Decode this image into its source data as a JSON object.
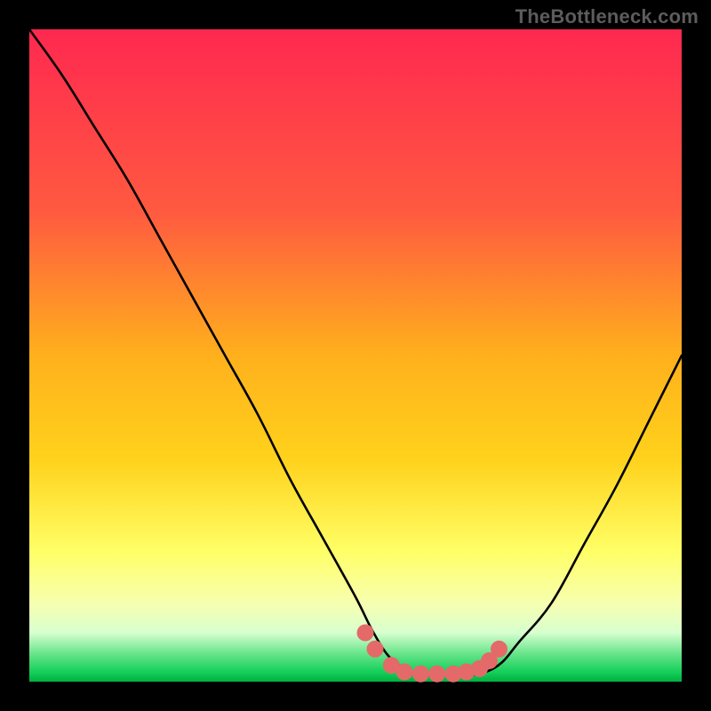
{
  "attribution": "TheBottleneck.com",
  "colors": {
    "frame": "#000000",
    "gradient_top": "#ff2850",
    "gradient_mid1": "#ff7a3a",
    "gradient_mid2": "#ffd21c",
    "gradient_mid3": "#ffff66",
    "gradient_mid4": "#f7ffb0",
    "gradient_bottom_band1": "#d7ffcf",
    "gradient_bottom_band2": "#6fe68f",
    "gradient_bottom_band3": "#15d05a",
    "curve": "#000000",
    "dots": "#e46a6a"
  },
  "chart_data": {
    "type": "line",
    "title": "",
    "xlabel": "",
    "ylabel": "",
    "x": [
      0.0,
      0.05,
      0.1,
      0.15,
      0.2,
      0.25,
      0.3,
      0.35,
      0.4,
      0.45,
      0.5,
      0.525,
      0.55,
      0.575,
      0.6,
      0.625,
      0.65,
      0.675,
      0.7,
      0.725,
      0.75,
      0.8,
      0.85,
      0.9,
      0.95,
      1.0
    ],
    "series": [
      {
        "name": "bottleneck-curve",
        "values": [
          1.0,
          0.93,
          0.85,
          0.77,
          0.68,
          0.59,
          0.5,
          0.41,
          0.31,
          0.22,
          0.13,
          0.08,
          0.04,
          0.02,
          0.01,
          0.01,
          0.01,
          0.01,
          0.015,
          0.03,
          0.06,
          0.12,
          0.21,
          0.3,
          0.4,
          0.5
        ]
      }
    ],
    "highlight_points": {
      "name": "bottleneck-band",
      "x": [
        0.515,
        0.53,
        0.555,
        0.575,
        0.6,
        0.625,
        0.65,
        0.67,
        0.69,
        0.705,
        0.72
      ],
      "values": [
        0.075,
        0.05,
        0.025,
        0.015,
        0.012,
        0.012,
        0.012,
        0.015,
        0.02,
        0.032,
        0.05
      ]
    },
    "xlim": [
      0,
      1
    ],
    "ylim": [
      0,
      1
    ]
  }
}
